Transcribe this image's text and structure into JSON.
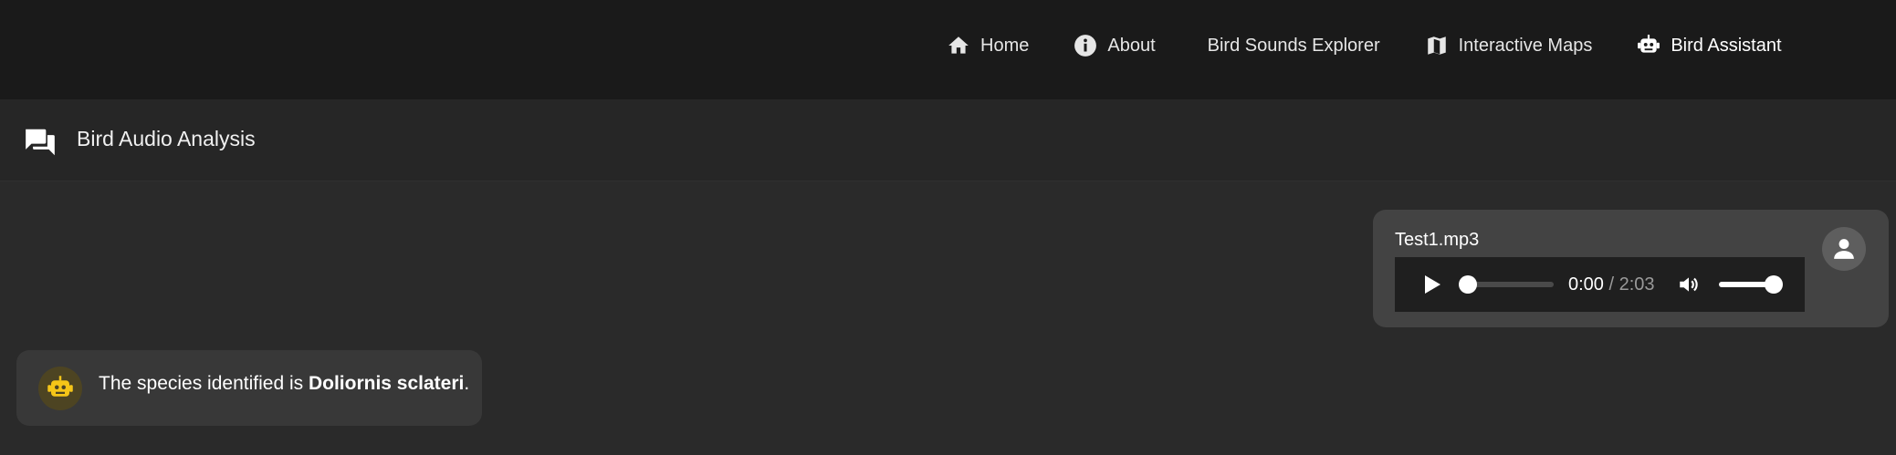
{
  "nav": {
    "items": [
      {
        "label": "Home",
        "icon": "home-icon"
      },
      {
        "label": "About",
        "icon": "info-icon"
      },
      {
        "label": "Bird Sounds Explorer",
        "icon": ""
      },
      {
        "label": "Interactive Maps",
        "icon": "map-icon"
      },
      {
        "label": "Bird Assistant",
        "icon": "robot-icon"
      }
    ]
  },
  "header": {
    "title": "Bird Audio Analysis",
    "icon": "chat-bubbles-icon"
  },
  "user_message": {
    "file_name": "Test1.mp3",
    "player": {
      "current_time": "0:00",
      "separator": " / ",
      "duration": "2:03",
      "progress_fraction": 0.0,
      "volume_fraction": 1.0
    },
    "avatar_icon": "user-icon"
  },
  "bot_message": {
    "text_prefix": "The species identified is ",
    "species": "Doliornis sclateri",
    "text_suffix": ".",
    "avatar_icon": "robot-icon"
  },
  "colors": {
    "background": "#2a2a2a",
    "nav_background": "#1a1a1a",
    "header_background": "#262626",
    "user_bubble": "#434343",
    "bot_bubble": "#383838",
    "bot_accent": "#f5c518"
  }
}
